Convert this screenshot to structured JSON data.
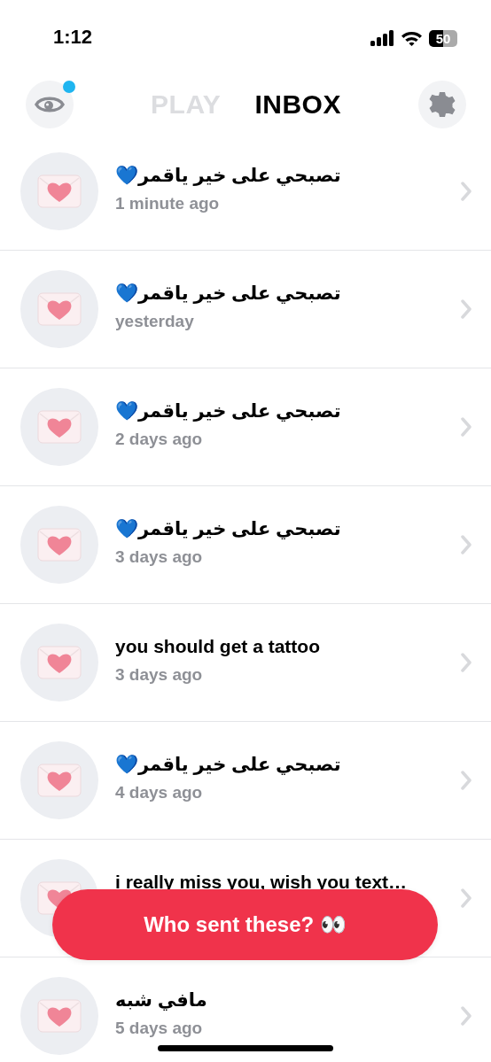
{
  "status_bar": {
    "time": "1:12",
    "battery": "50"
  },
  "header": {
    "notification_dot": true,
    "play_tab": {
      "label": "PLAY",
      "selected": false
    },
    "inbox_tab": {
      "label": "INBOX",
      "selected": true
    }
  },
  "messages": [
    {
      "title": "تصبحي على خير ياقمر💙",
      "time": "1 minute ago"
    },
    {
      "title": "تصبحي على خير ياقمر💙",
      "time": "yesterday"
    },
    {
      "title": "تصبحي على خير ياقمر💙",
      "time": "2 days ago"
    },
    {
      "title": "تصبحي على خير ياقمر💙",
      "time": "3 days ago"
    },
    {
      "title": "you should get a tattoo",
      "time": "3 days ago"
    },
    {
      "title": "تصبحي على خير ياقمر💙",
      "time": "4 days ago"
    },
    {
      "title": "i really miss you, wish you text…"
    },
    {
      "title": "مافي شبه",
      "time": "5 days ago"
    }
  ],
  "reveal_button": {
    "label": "Who sent these? 👀"
  }
}
